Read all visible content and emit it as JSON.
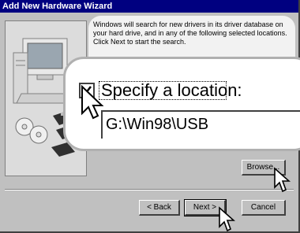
{
  "window": {
    "title": "Add New Hardware Wizard"
  },
  "description": "Windows will search for new drivers in its driver database on your hard drive, and in any of the following selected locations. Click Next to start the search.",
  "location_option": {
    "label": "Specify a location:",
    "checked": true
  },
  "location_field": {
    "value": "G:\\Win98\\USB"
  },
  "buttons": {
    "browse": "Browse...",
    "back": "< Back",
    "next": "Next >",
    "cancel": "Cancel"
  },
  "icons": [
    "computer-icon",
    "cd-disc-icon",
    "floppy-disk-icon",
    "mouse-pointer-cursor-icon",
    "check-mark-icon"
  ],
  "colors": {
    "titlebar": "#000080",
    "dialog_face": "#c0c0c0"
  }
}
